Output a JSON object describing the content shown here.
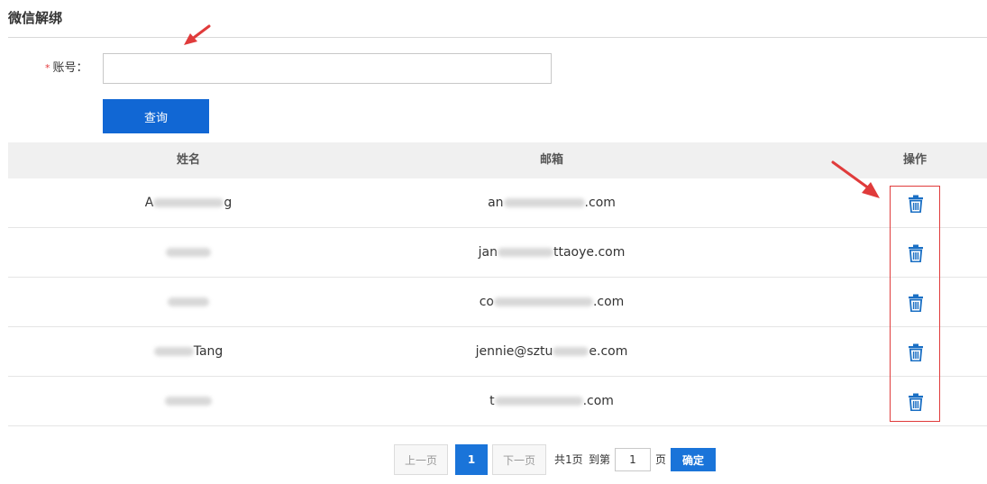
{
  "page": {
    "title": "微信解绑"
  },
  "form": {
    "required_mark": "*",
    "account_label": "账号：",
    "account_value": "",
    "query_button": "查询"
  },
  "table": {
    "headers": {
      "name": "姓名",
      "email": "邮箱",
      "action": "操作"
    },
    "rows": [
      {
        "name_prefix": "A",
        "name_suffix": "g",
        "email_prefix": "an",
        "email_suffix": ".com",
        "action_icon": "trash-icon"
      },
      {
        "name_prefix": "",
        "name_suffix": "",
        "email_prefix": "jan",
        "email_suffix": "ttaoye.com",
        "action_icon": "trash-icon"
      },
      {
        "name_prefix": "",
        "name_suffix": "",
        "email_prefix": "co",
        "email_suffix": ".com",
        "action_icon": "trash-icon"
      },
      {
        "name_prefix": "",
        "name_suffix": "Tang",
        "email_prefix": "jennie@sztu",
        "email_suffix": "e.com",
        "action_icon": "trash-icon"
      },
      {
        "name_prefix": "",
        "name_suffix": "",
        "email_prefix": "t",
        "email_suffix": ".com",
        "action_icon": "trash-icon"
      }
    ]
  },
  "pagination": {
    "prev": "上一页",
    "current": "1",
    "next": "下一页",
    "total": "共1页",
    "goto": "到第",
    "page_input": "1",
    "page_unit": "页",
    "confirm": "确定"
  },
  "colors": {
    "primary": "#1167d4",
    "icon": "#1a6fc4",
    "annotation": "#e03b3b",
    "header_bg": "#f0f0f0"
  }
}
